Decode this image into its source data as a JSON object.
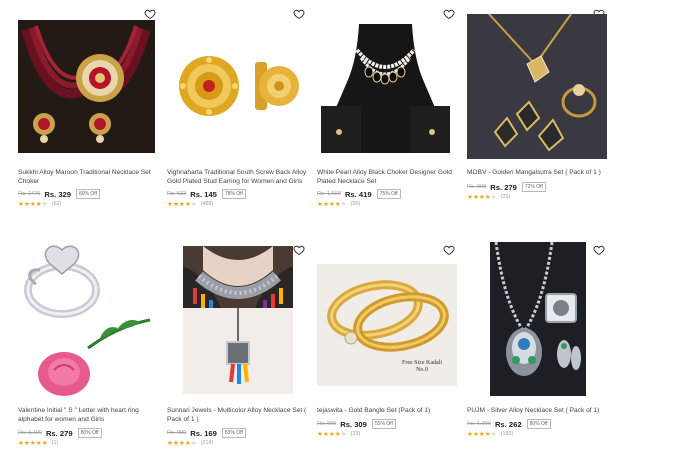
{
  "colors": {
    "star": "#f2a515",
    "star_empty": "#d8d8d8",
    "text": "#444444",
    "muted": "#a0a0a0"
  },
  "products": [
    {
      "title": "Sukkhi Alloy Maroon Traditional Necklace Set Choker",
      "mrp": "Rs. 1470",
      "price": "Rs. 329",
      "off": "80% Off",
      "rating": 4,
      "reviews": "(62)",
      "image": "maroon-kundan-necklace-set"
    },
    {
      "title": "Vighnaharta Traditional South Screw Back Alloy Gold Plated Stud Earring for Women and Girls",
      "mrp": "Rs. 533",
      "price": "Rs. 145",
      "off": "78% Off",
      "rating": 4,
      "reviews": "(488)",
      "image": "gold-stud-earrings"
    },
    {
      "title": "White Pearl Alloy Black Choker Designer Gold Plated Necklace Set",
      "mrp": "Rs. 1,699",
      "price": "Rs. 419",
      "off": "75% Off",
      "rating": 4,
      "reviews": "(55)",
      "image": "pearl-choker-on-bust"
    },
    {
      "title": "MOBV - Golden Mangalsutra Set ( Pack of 1 )",
      "mrp": "Rs. 999",
      "price": "Rs. 279",
      "off": "72% Off",
      "rating": 4,
      "reviews": "(25)",
      "image": "mangalsutra-set"
    },
    {
      "title": "Valentine Initial \" S \" Letter with heart ring alphabet for women and Girls",
      "mrp": "Rs. 1,199",
      "price": "Rs. 279",
      "off": "80% Off",
      "rating": 5,
      "reviews": "(1)",
      "image": "silver-ring-with-rose"
    },
    {
      "title": "Sunnari Jewels - Multicolor Alloy Necklace Set ( Pack of 1 )",
      "mrp": "Rs. 999",
      "price": "Rs. 169",
      "off": "83% Off",
      "rating": 4,
      "reviews": "(214)",
      "image": "tribal-choker-with-tassels"
    },
    {
      "title": "tejaswita - Gold Bangle Set (Pack of 1)",
      "mrp": "Rs. 699",
      "price": "Rs. 309",
      "off": "55% Off",
      "rating": 4,
      "reviews": "(33)",
      "image": "gold-bangle-pair",
      "image_caption": "Free Size Kadali\nNo.9"
    },
    {
      "title": "PUJM - Silver Alloy Necklace Set ( Pack of 1)",
      "mrp": "Rs. 1,399",
      "price": "Rs. 262",
      "off": "80% Off",
      "rating": 4,
      "reviews": "(183)",
      "image": "silver-peacock-necklace"
    }
  ]
}
